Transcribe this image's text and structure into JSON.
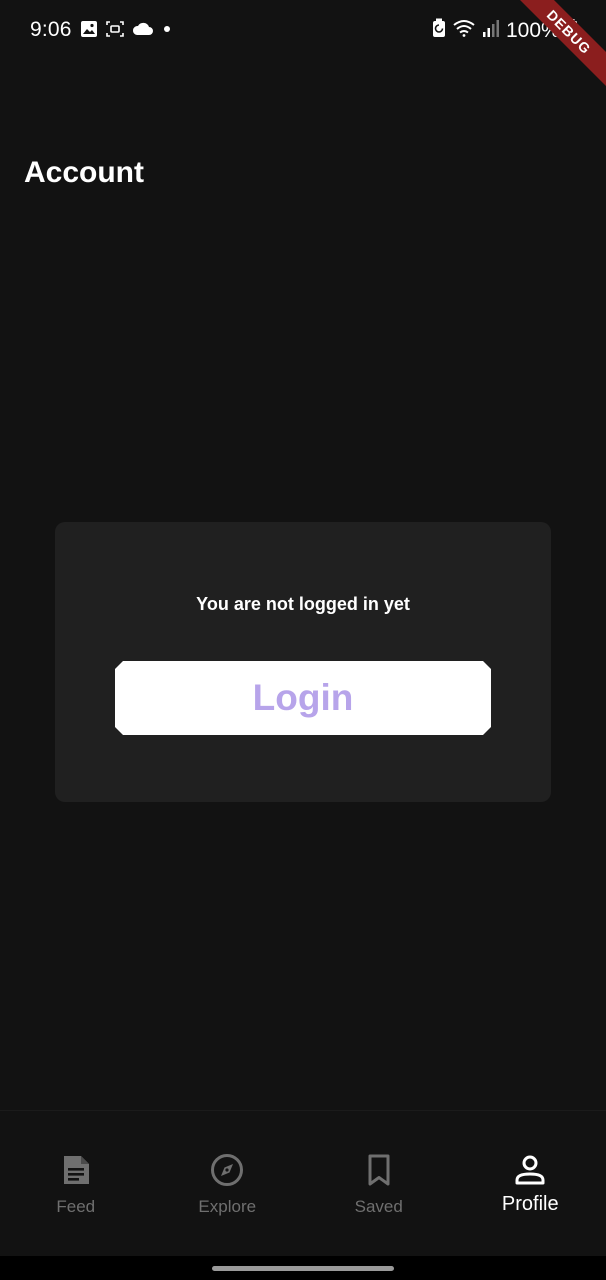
{
  "status_bar": {
    "time": "9:06",
    "battery_text": "100%",
    "left_icons": [
      "image-icon",
      "screenshot-icon",
      "cloud-icon",
      "dot-icon"
    ],
    "right_icons": [
      "battery-saver-icon",
      "wifi-icon",
      "signal-icon",
      "battery-icon"
    ],
    "debug_banner": "DEBUG"
  },
  "header": {
    "title": "Account"
  },
  "card": {
    "message": "You are not logged in yet",
    "login_label": "Login"
  },
  "bottom_nav": {
    "items": [
      {
        "label": "Feed",
        "icon": "article-icon",
        "active": false
      },
      {
        "label": "Explore",
        "icon": "compass-icon",
        "active": false
      },
      {
        "label": "Saved",
        "icon": "bookmark-icon",
        "active": false
      },
      {
        "label": "Profile",
        "icon": "person-icon",
        "active": true
      }
    ]
  },
  "colors": {
    "background": "#121212",
    "card": "#202020",
    "accent": "#b7a4ea",
    "inactive": "#6f6f6f",
    "active": "#ffffff",
    "debug_ribbon": "#8b1e1e"
  }
}
